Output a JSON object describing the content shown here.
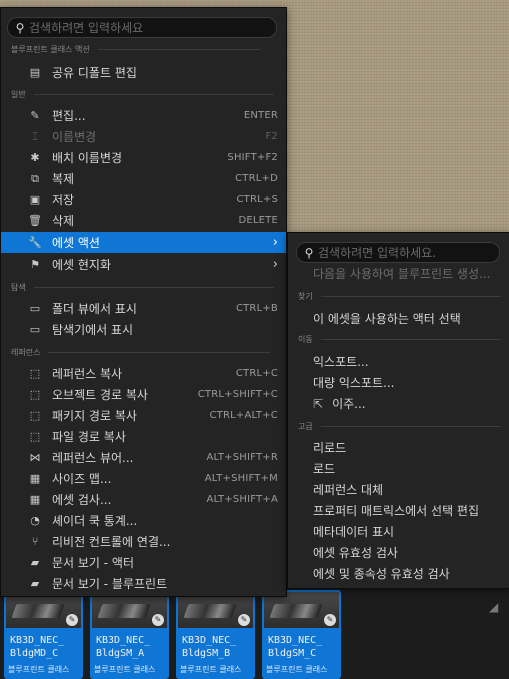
{
  "main_menu": {
    "search_placeholder": "검색하려면 입력하세요",
    "sections": {
      "blueprint_class_actions": "블루프린트 클래스 액션",
      "general": "일반",
      "explore": "탐색",
      "references": "레퍼런스"
    },
    "blueprint_actions": [
      {
        "label": "공유 디폴트 편집",
        "icon": "shared-defaults-icon"
      }
    ],
    "general_items": [
      {
        "label": "편집...",
        "shortcut": "ENTER",
        "icon": "pencil-icon",
        "disabled": false
      },
      {
        "label": "이름변경",
        "shortcut": "F2",
        "icon": "rename-icon",
        "disabled": true
      },
      {
        "label": "배치 이름변경",
        "shortcut": "SHIFT+F2",
        "icon": "batch-rename-icon",
        "disabled": false
      },
      {
        "label": "복제",
        "shortcut": "CTRL+D",
        "icon": "duplicate-icon",
        "disabled": false
      },
      {
        "label": "저장",
        "shortcut": "CTRL+S",
        "icon": "save-icon",
        "disabled": false
      },
      {
        "label": "삭제",
        "shortcut": "DELETE",
        "icon": "trash-icon",
        "disabled": false
      },
      {
        "label": "에셋 액션",
        "shortcut": "",
        "icon": "wrench-icon",
        "disabled": false,
        "active": true,
        "submenu": true
      },
      {
        "label": "에셋 현지화",
        "shortcut": "",
        "icon": "flag-icon",
        "disabled": false,
        "submenu": true
      }
    ],
    "explore_items": [
      {
        "label": "폴더 뷰에서 표시",
        "shortcut": "CTRL+B",
        "icon": "folder-search-icon"
      },
      {
        "label": "탐색기에서 표시",
        "shortcut": "",
        "icon": "explorer-search-icon"
      }
    ],
    "reference_items": [
      {
        "label": "레퍼런스 복사",
        "shortcut": "CTRL+C",
        "icon": "copy-reference-icon"
      },
      {
        "label": "오브젝트 경로 복사",
        "shortcut": "CTRL+SHIFT+C",
        "icon": "copy-object-path-icon"
      },
      {
        "label": "패키지 경로 복사",
        "shortcut": "CTRL+ALT+C",
        "icon": "copy-package-path-icon"
      },
      {
        "label": "파일 경로 복사",
        "shortcut": "",
        "icon": "copy-file-path-icon"
      },
      {
        "label": "레퍼런스 뷰어...",
        "shortcut": "ALT+SHIFT+R",
        "icon": "reference-viewer-icon"
      },
      {
        "label": "사이즈 맵...",
        "shortcut": "ALT+SHIFT+M",
        "icon": "size-map-icon"
      },
      {
        "label": "에셋 검사...",
        "shortcut": "ALT+SHIFT+A",
        "icon": "asset-audit-icon"
      },
      {
        "label": "셰이더 쿡 통계...",
        "shortcut": "",
        "icon": "shader-stats-icon"
      },
      {
        "label": "리비전 컨트롤에 연결...",
        "shortcut": "",
        "icon": "revision-control-icon"
      },
      {
        "label": "문서 보기 - 액터",
        "shortcut": "",
        "icon": "docs-book-icon"
      },
      {
        "label": "문서 보기 - 블루프린트",
        "shortcut": "",
        "icon": "docs-book-icon"
      }
    ]
  },
  "sub_menu": {
    "search_placeholder": "검색하려면 입력하세요.",
    "blueprint_hint": "다음을 사용하여 블루프린트 생성...",
    "sections": {
      "find": "찾기",
      "move": "이동",
      "advanced": "고급"
    },
    "find_items": [
      "이 에셋을 사용하는 액터 선택"
    ],
    "move_items": [
      {
        "label": "익스포트...",
        "icon": ""
      },
      {
        "label": "대량 익스포트...",
        "icon": ""
      },
      {
        "label": "이주...",
        "icon": "migrate-icon"
      }
    ],
    "advanced_items": [
      "리로드",
      "로드",
      "레퍼런스 대체",
      "프로퍼티 매트릭스에서 선택 편집",
      "메타데이터 표시",
      "에셋 유효성 검사",
      "에셋 및 종속성 유효성 검사"
    ]
  },
  "assets": [
    {
      "name": "KB3D_NEC_\nBldgMD_C",
      "type": "블루프린트 클래스"
    },
    {
      "name": "KB3D_NEC_\nBldgSM_A",
      "type": "블루프린트 클래스"
    },
    {
      "name": "KB3D_NEC_\nBldgSM_B",
      "type": "블루프린트 클래스"
    },
    {
      "name": "KB3D_NEC_\nBldgSM_C",
      "type": "블루프린트 클래스"
    }
  ],
  "colors": {
    "menu_bg": "#242424",
    "active": "#0f76d6",
    "asset_tile": "#0f76d6"
  }
}
